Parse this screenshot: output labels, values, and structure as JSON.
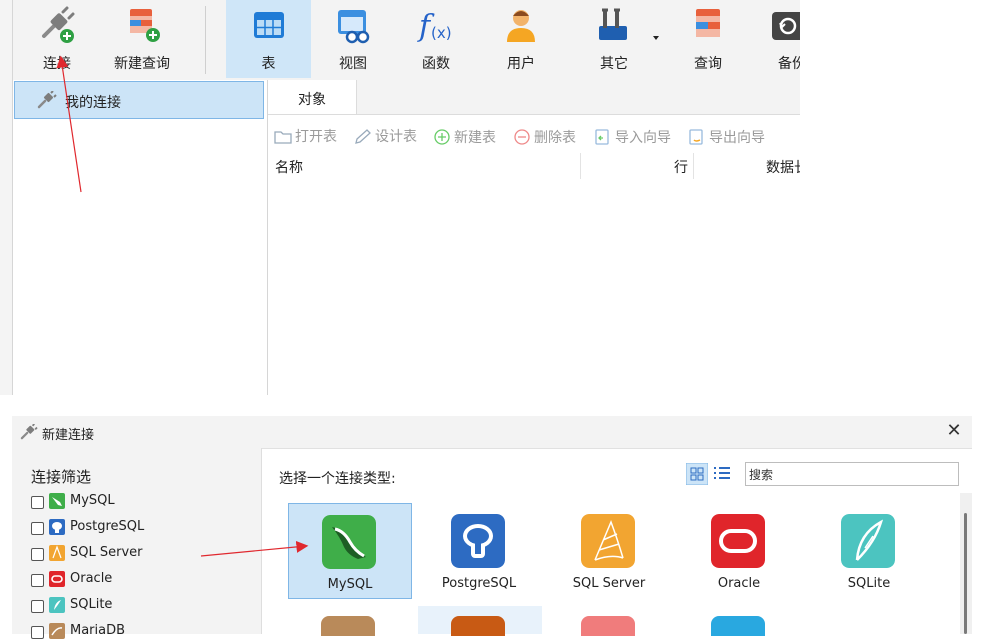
{
  "toolbar": {
    "connect_label": "连接",
    "new_query_label": "新建查询",
    "table_label": "表",
    "view_label": "视图",
    "function_label": "函数",
    "user_label": "用户",
    "other_label": "其它",
    "query_label": "查询",
    "backup_label": "备份"
  },
  "tree": {
    "my_connection_label": "我的连接"
  },
  "tabs": {
    "objects_label": "对象"
  },
  "object_toolbar": {
    "open_table": "打开表",
    "design_table": "设计表",
    "new_table": "新建表",
    "delete_table": "删除表",
    "import_wizard": "导入向导",
    "export_wizard": "导出向导"
  },
  "columns": {
    "name": "名称",
    "rows": "行",
    "data": "数据长"
  },
  "dialog": {
    "title": "新建连接",
    "close_symbol": "✕",
    "filter_title": "连接筛选",
    "filters": [
      "MySQL",
      "PostgreSQL",
      "SQL Server",
      "Oracle",
      "SQLite",
      "MariaDB"
    ],
    "choose_type_label": "选择一个连接类型:",
    "search_placeholder": "搜索",
    "types": [
      "MySQL",
      "PostgreSQL",
      "SQL Server",
      "Oracle",
      "SQLite"
    ],
    "selected_type": "MySQL"
  },
  "colors": {
    "selection_bg": "#cce4f7",
    "selection_border": "#7fb6e6",
    "annotation_arrow": "#e0282e",
    "mysql": "#3fae49",
    "postgresql": "#2d6bc2",
    "sqlserver": "#f2a531",
    "oracle": "#e0252b",
    "sqlite": "#4cc4c0"
  }
}
